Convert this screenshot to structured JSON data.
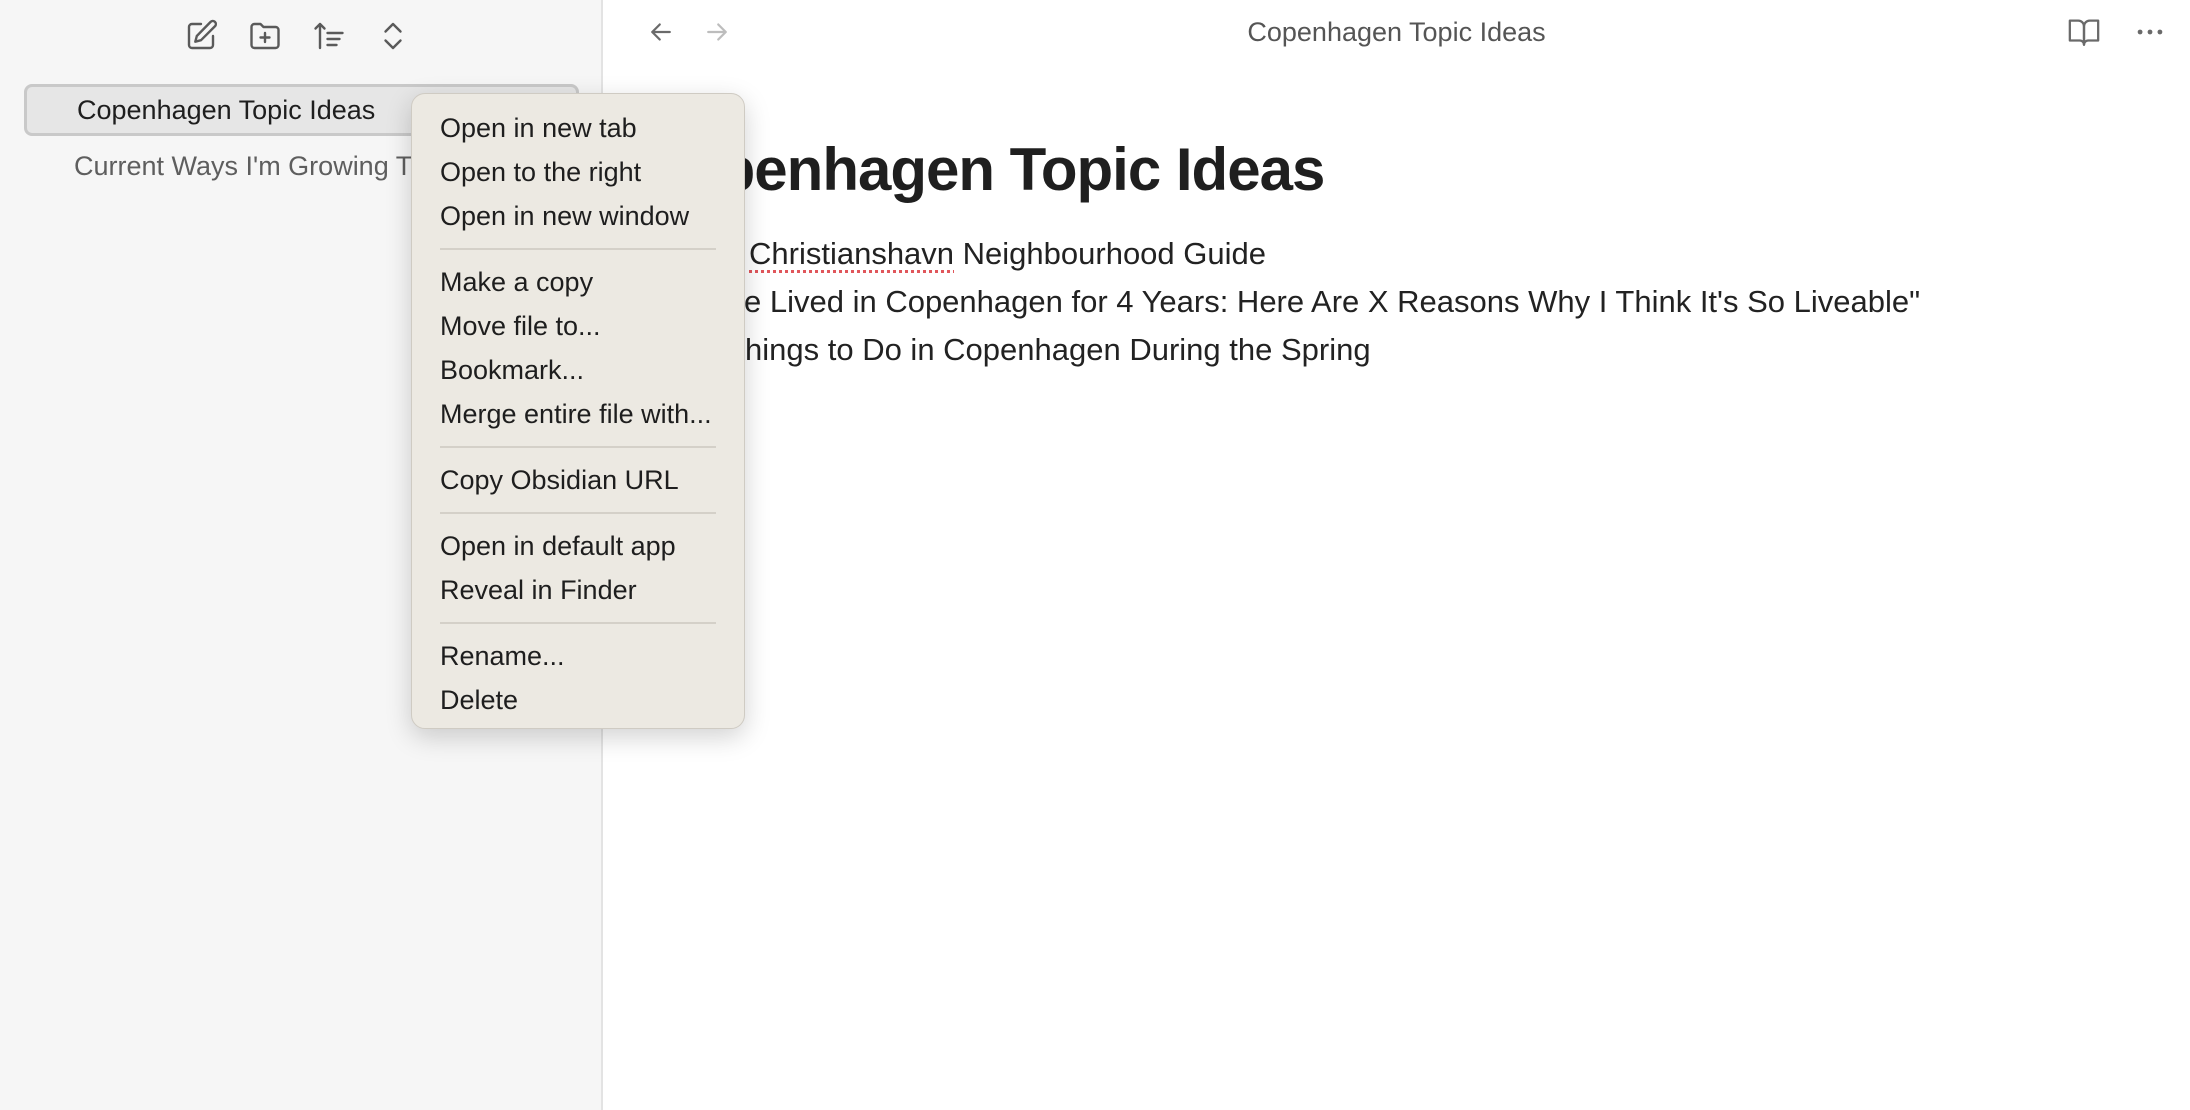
{
  "sidebar": {
    "toolbar": {
      "icons": [
        "new-note-icon",
        "new-folder-icon",
        "sort-icon",
        "collapse-expand-icon"
      ]
    },
    "files": [
      {
        "label": "Copenhagen Topic Ideas",
        "active": true
      },
      {
        "label": "Current Ways I'm Growing T",
        "active": false
      }
    ]
  },
  "main": {
    "title": "Copenhagen Topic Ideas",
    "nav": {
      "back_icon": "arrow-left-icon",
      "forward_icon": "arrow-right-icon"
    },
    "right_icons": [
      "reading-view-icon",
      "more-options-icon"
    ],
    "note": {
      "heading": "openhagen Topic Ideas",
      "lines": [
        {
          "prefix": "Christianshavn",
          "rest": " Neighbourhood Guide"
        },
        {
          "text": "e Lived in Copenhagen for 4 Years: Here Are X Reasons Why I Think It's So Liveable\""
        },
        {
          "text": "hings to Do in Copenhagen During the Spring"
        }
      ]
    }
  },
  "context_menu": {
    "groups": [
      [
        "Open in new tab",
        "Open to the right",
        "Open in new window"
      ],
      [
        "Make a copy",
        "Move file to...",
        "Bookmark...",
        "Merge entire file with..."
      ],
      [
        "Copy Obsidian URL"
      ],
      [
        "Open in default app",
        "Reveal in Finder"
      ],
      [
        "Rename...",
        "Delete"
      ]
    ]
  },
  "colors": {
    "sidebar_bg": "#f6f6f6",
    "menu_bg": "#ece9e2",
    "spell_underline": "#e0565b"
  }
}
